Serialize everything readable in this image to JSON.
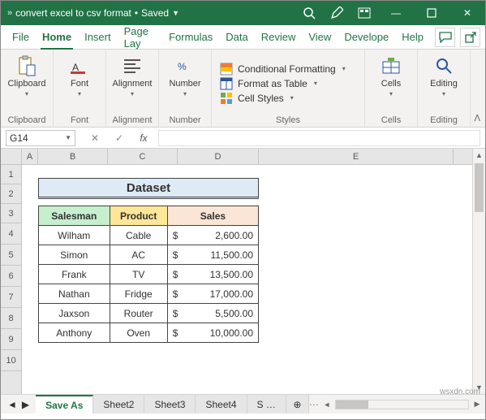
{
  "title": {
    "chev": "»",
    "file": "convert excel to csv format",
    "status": "Saved",
    "bullet": "•"
  },
  "win": {
    "min": "—",
    "max": "▢",
    "close": "✕"
  },
  "menu": {
    "file": "File",
    "home": "Home",
    "insert": "Insert",
    "page": "Page Lay",
    "formulas": "Formulas",
    "data": "Data",
    "review": "Review",
    "view": "View",
    "dev": "Develope",
    "help": "Help",
    "comment": "💬",
    "share": "↗"
  },
  "ribbon": {
    "clipboard": "Clipboard",
    "font": "Font",
    "alignment": "Alignment",
    "number": "Number",
    "condfmt": "Conditional Formatting",
    "fmttable": "Format as Table",
    "cellstyles": "Cell Styles",
    "styles": "Styles",
    "cells": "Cells",
    "editing": "Editing",
    "collapse": "ᐱ"
  },
  "namebox": "G14",
  "fx": {
    "x": "✕",
    "chk": "✓",
    "fx": "fx"
  },
  "cols": [
    "A",
    "B",
    "C",
    "D",
    "E"
  ],
  "rows": [
    "1",
    "2",
    "3",
    "4",
    "5",
    "6",
    "7",
    "8",
    "9",
    "10"
  ],
  "dataset": {
    "title": "Dataset",
    "headers": {
      "a": "Salesman",
      "b": "Product",
      "c": "Sales"
    },
    "cur": "$",
    "data": [
      {
        "s": "Wilham",
        "p": "Cable",
        "v": "2,600.00"
      },
      {
        "s": "Simon",
        "p": "AC",
        "v": "11,500.00"
      },
      {
        "s": "Frank",
        "p": "TV",
        "v": "13,500.00"
      },
      {
        "s": "Nathan",
        "p": "Fridge",
        "v": "17,000.00"
      },
      {
        "s": "Jaxson",
        "p": "Router",
        "v": "5,500.00"
      },
      {
        "s": "Anthony",
        "p": "Oven",
        "v": "10,000.00"
      }
    ]
  },
  "tabs": {
    "nav1": "◄",
    "nav2": "▶",
    "t1": "Save As",
    "t2": "Sheet2",
    "t3": "Sheet3",
    "t4": "Sheet4",
    "t5": "S …",
    "add": "⊕",
    "dots": "⋯"
  },
  "watermark": "wsxdn.com"
}
